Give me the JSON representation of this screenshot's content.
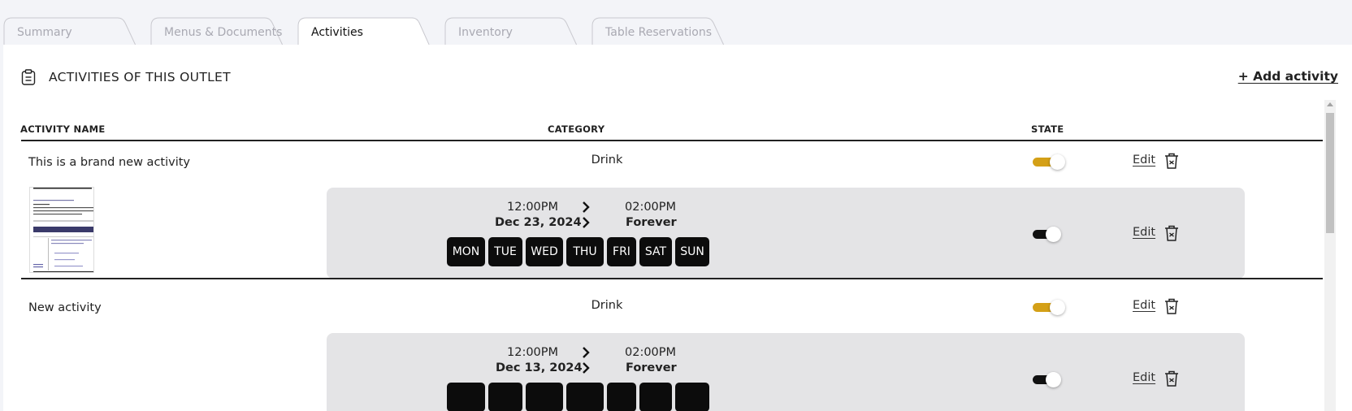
{
  "tabs": [
    {
      "label": "Summary",
      "active": false
    },
    {
      "label": "Menus & Documents",
      "active": false
    },
    {
      "label": "Activities",
      "active": true
    },
    {
      "label": "Inventory",
      "active": false
    },
    {
      "label": "Table Reservations",
      "active": false
    }
  ],
  "section": {
    "title": "ACTIVITIES OF THIS OUTLET",
    "add_label": "+ Add activity",
    "icon": "clipboard-icon"
  },
  "table": {
    "headers": {
      "name": "ACTIVITY NAME",
      "category": "CATEGORY",
      "state": "STATE"
    }
  },
  "activities": [
    {
      "name": "This is a brand new activity",
      "category": "Drink",
      "state": "on",
      "edit_label": "Edit",
      "schedule": {
        "start_time": "12:00PM",
        "end_time": "02:00PM",
        "start_date": "Dec 23, 2024",
        "end_date": "Forever",
        "days": [
          "MON",
          "TUE",
          "WED",
          "THU",
          "FRI",
          "SAT",
          "SUN"
        ],
        "state": "on",
        "edit_label": "Edit"
      }
    },
    {
      "name": "New activity",
      "category": "Drink",
      "state": "on",
      "edit_label": "Edit",
      "schedule": {
        "start_time": "12:00PM",
        "end_time": "02:00PM",
        "start_date": "Dec 13, 2024",
        "end_date": "Forever",
        "state": "on",
        "edit_label": "Edit"
      }
    }
  ],
  "colors": {
    "toggle_on": "#d4a017",
    "toggle_dark": "#111111",
    "day_chip": "#0c0c0c",
    "schedule_bg": "#e4e4e6"
  }
}
